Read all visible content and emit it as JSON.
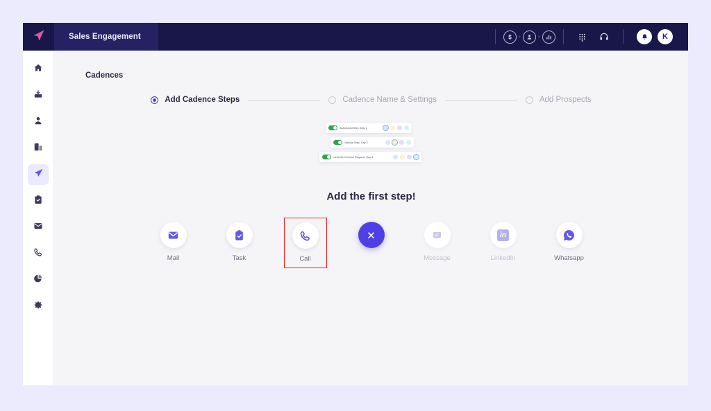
{
  "topbar": {
    "logo_icon": "paper-plane-logo",
    "app_tab_label": "Sales Engagement",
    "icons": [
      {
        "name": "dollar-icon",
        "glyph": "$"
      },
      {
        "name": "person-icon",
        "glyph": "person"
      },
      {
        "name": "analytics-icon",
        "glyph": "bar-chart"
      },
      {
        "name": "dialpad-icon",
        "glyph": "dialpad"
      },
      {
        "name": "headset-icon",
        "glyph": "headset"
      },
      {
        "name": "notification-bell-icon",
        "glyph": "bell"
      }
    ],
    "avatar_initial": "K"
  },
  "sidebar": {
    "items": [
      {
        "name": "sidebar-item-home",
        "icon": "home-icon",
        "active": false
      },
      {
        "name": "sidebar-item-inbox",
        "icon": "inbox-icon",
        "active": false
      },
      {
        "name": "sidebar-item-contacts",
        "icon": "person-icon",
        "active": false
      },
      {
        "name": "sidebar-item-documents",
        "icon": "documents-icon",
        "active": false
      },
      {
        "name": "sidebar-item-cadences",
        "icon": "paper-plane-icon",
        "active": true
      },
      {
        "name": "sidebar-item-tasks",
        "icon": "clipboard-check-icon",
        "active": false
      },
      {
        "name": "sidebar-item-mail",
        "icon": "envelope-icon",
        "active": false
      },
      {
        "name": "sidebar-item-calls",
        "icon": "phone-icon",
        "active": false
      },
      {
        "name": "sidebar-item-reports",
        "icon": "pie-chart-icon",
        "active": false
      },
      {
        "name": "sidebar-item-settings",
        "icon": "gear-icon",
        "active": false
      }
    ]
  },
  "page": {
    "title": "Cadences"
  },
  "stepper": {
    "steps": [
      {
        "label": "Add Cadence Steps",
        "active": true
      },
      {
        "label": "Cadence Name & Settings",
        "active": false
      },
      {
        "label": "Add Prospects",
        "active": false
      }
    ]
  },
  "preview_cards": [
    {
      "label": "Automated Step, Day 1",
      "toggle": "on"
    },
    {
      "label": "Manual Step, Day 2",
      "toggle": "on"
    },
    {
      "label": "LinkedIn Connect Request, Day 3",
      "toggle": "on"
    }
  ],
  "main": {
    "headline": "Add the first step!",
    "step_buttons": [
      {
        "label": "Mail",
        "icon": "envelope-icon",
        "state": "enabled",
        "highlighted": false
      },
      {
        "label": "Task",
        "icon": "clipboard-check-icon",
        "state": "enabled",
        "highlighted": false
      },
      {
        "label": "Call",
        "icon": "phone-icon",
        "state": "enabled",
        "highlighted": true
      },
      {
        "label": "",
        "icon": "close-x-icon",
        "state": "solid",
        "highlighted": false
      },
      {
        "label": "Message",
        "icon": "message-icon",
        "state": "disabled",
        "highlighted": false
      },
      {
        "label": "LinkedIn",
        "icon": "linkedin-icon",
        "state": "disabled",
        "highlighted": false
      },
      {
        "label": "Whatsapp",
        "icon": "whatsapp-icon",
        "state": "enabled",
        "highlighted": false
      }
    ]
  },
  "colors": {
    "accent": "#4f40e4",
    "navy": "#191749",
    "navy_tab": "#252263",
    "page_bg": "#ecebfd",
    "content_bg": "#f5f5f7",
    "highlight_outline": "#ee1c1c",
    "toggle_on": "#2ea44f"
  }
}
